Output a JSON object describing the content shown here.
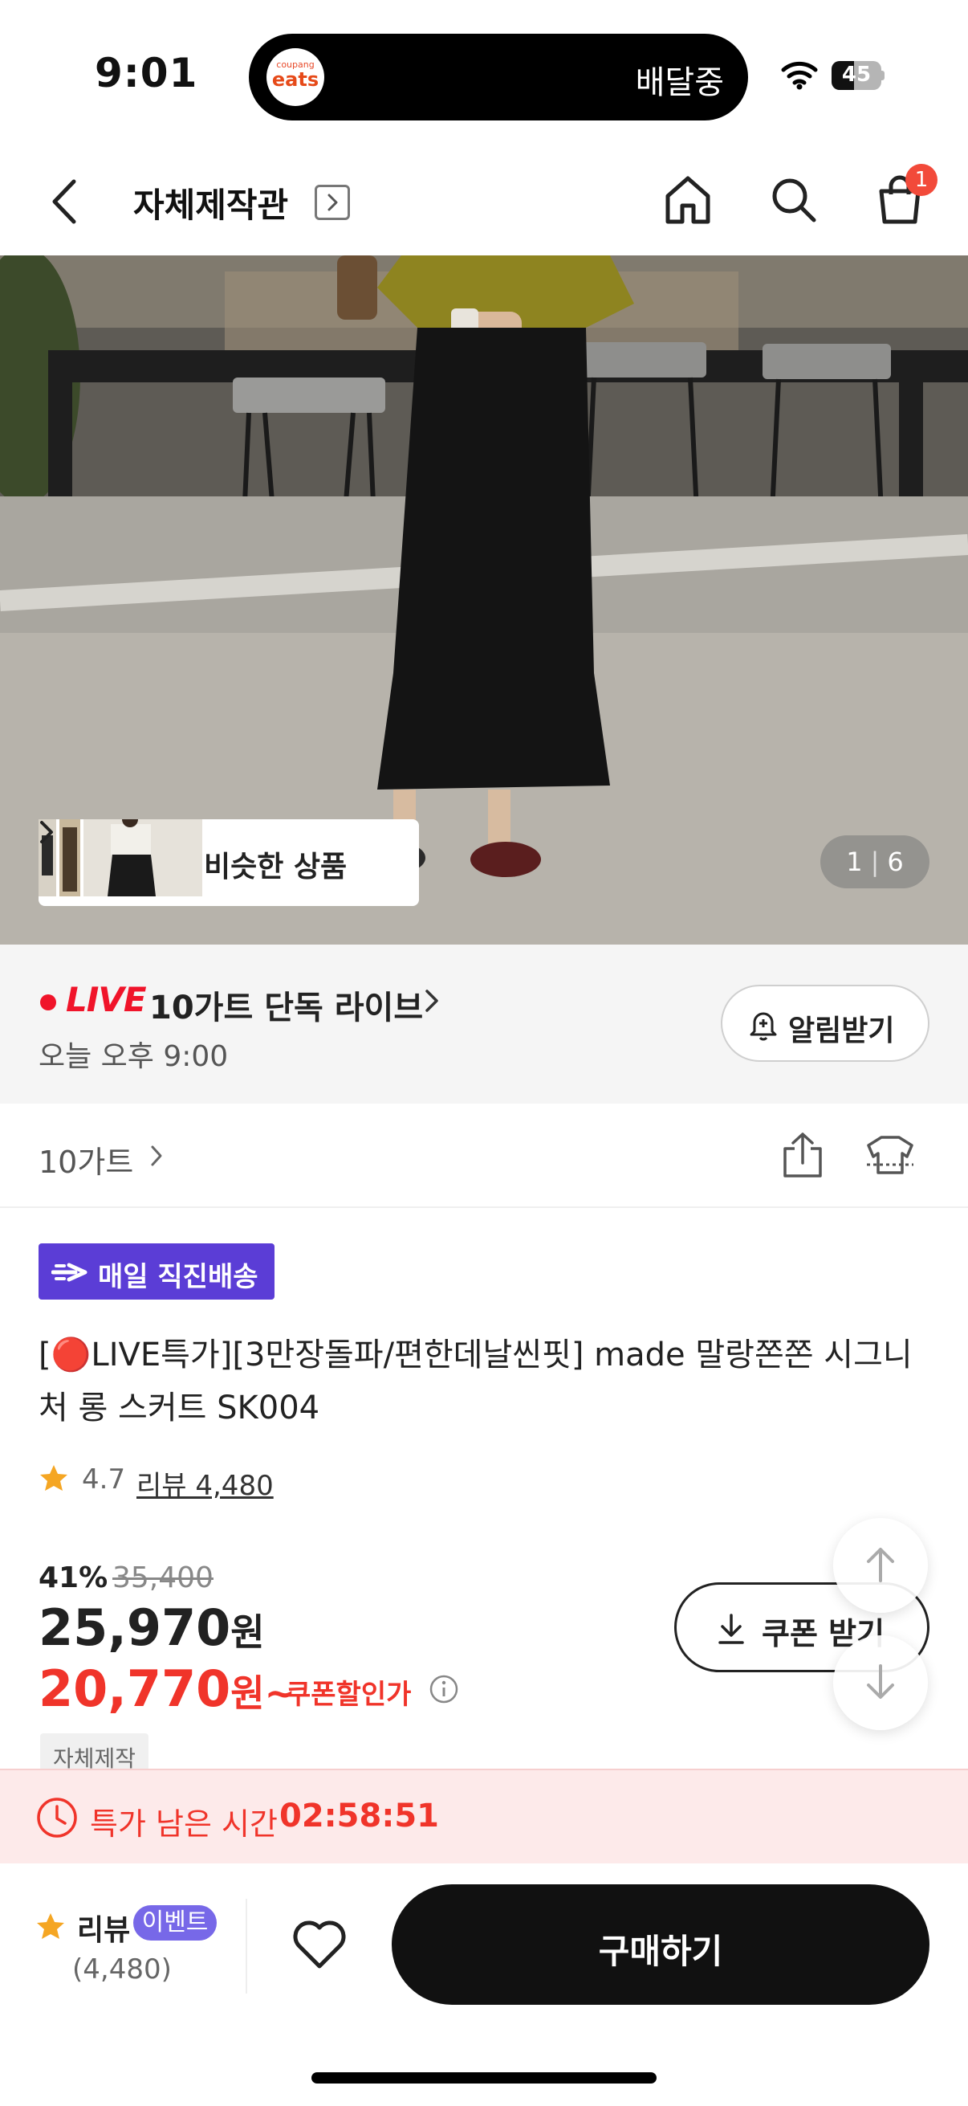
{
  "status_bar": {
    "time": "9:01",
    "activity_logo_top": "coupang",
    "activity_logo_bottom": "eats",
    "activity_text": "배달중",
    "battery_level": "45",
    "battery_fraction": 0.45
  },
  "header": {
    "title": "자체제작관",
    "cart_count": "1",
    "icons": [
      "back-icon",
      "chevron-right-icon",
      "home-icon",
      "search-icon",
      "cart-icon"
    ]
  },
  "hero": {
    "similar_label": "비슷한 상품",
    "page_current": "1",
    "page_total": "6"
  },
  "live": {
    "badge": "LIVE",
    "title": "10가트 단독 라이브",
    "time": "오늘 오후 9:00",
    "alarm_label": "알림받기"
  },
  "brand": {
    "name": "10가트",
    "icons": [
      "share-icon",
      "outfit-icon"
    ]
  },
  "product": {
    "delivery_badge": "매일 직진배송",
    "title": "[🔴LIVE특가][3만장돌파/편한데날씬핏] made 말랑쫀쫀 시그니처 롱 스커트 SK004",
    "rating": "4.7",
    "review_link": "리뷰 4,480",
    "discount_rate": "41%",
    "original_price": "35,400",
    "sale_price": "25,970",
    "sale_unit": "원",
    "coupon_price": "20,770",
    "coupon_unit": "원~",
    "coupon_note": "쿠폰할인가",
    "coupon_button": "쿠폰 받기",
    "tag": "자체제작"
  },
  "timer": {
    "label": "특가 남은 시간",
    "value": "02:58:51"
  },
  "bottom_bar": {
    "review_title": "리뷰",
    "event_badge": "이벤트",
    "review_count": "(4,480)",
    "buy_label": "구매하기"
  },
  "colors": {
    "accent_red": "#f0342a",
    "delivery_purple": "#5b3dd6",
    "event_purple": "#7768e8",
    "star": "#f5a623",
    "buy_button": "#111111"
  }
}
